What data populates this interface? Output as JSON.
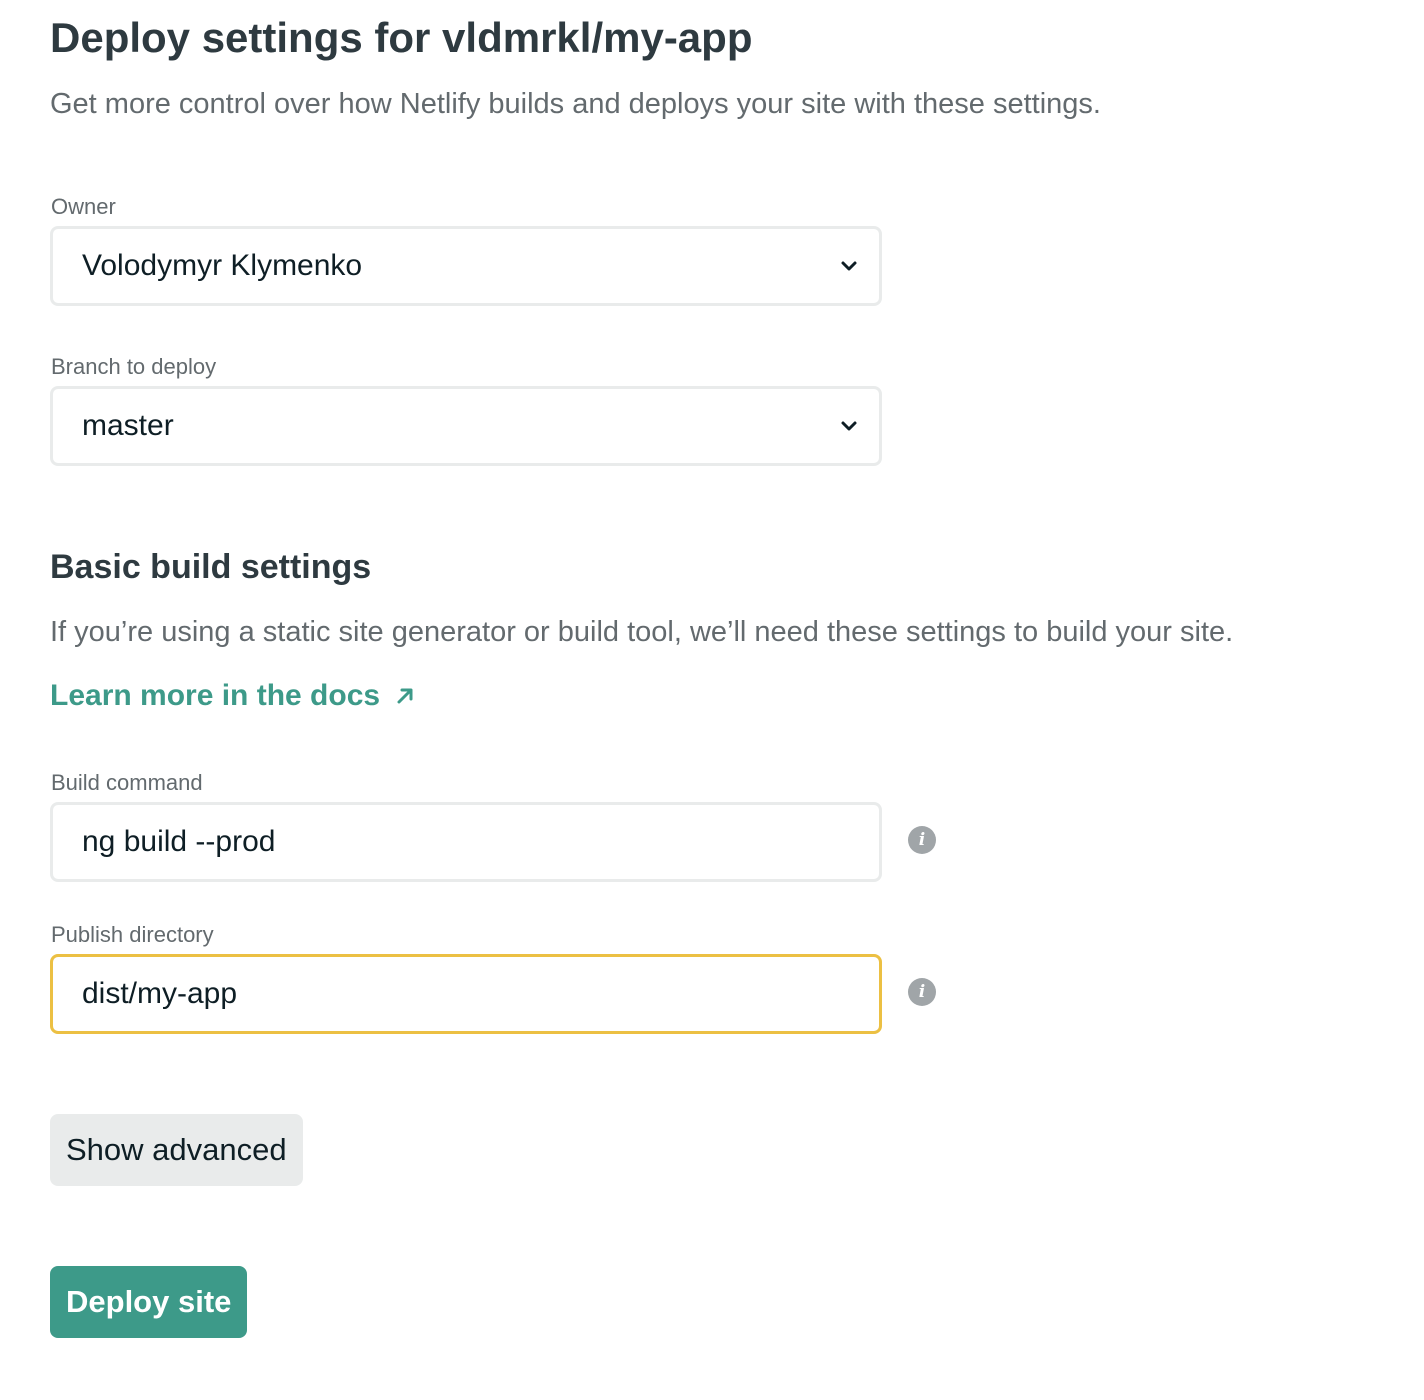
{
  "header": {
    "title": "Deploy settings for vldmrkl/my-app",
    "subtitle": "Get more control over how Netlify builds and deploys your site with these settings."
  },
  "owner": {
    "label": "Owner",
    "value": "Volodymyr Klymenko",
    "icon": "chevron-down-icon"
  },
  "branch": {
    "label": "Branch to deploy",
    "value": "master",
    "icon": "chevron-down-icon"
  },
  "build_settings": {
    "title": "Basic build settings",
    "description": "If you’re using a static site generator or build tool, we’ll need these settings to build your site.",
    "docs_link": "Learn more in the docs",
    "docs_link_icon": "external-arrow-icon",
    "build_command": {
      "label": "Build command",
      "value": "ng build --prod",
      "info_icon": "i"
    },
    "publish_directory": {
      "label": "Publish directory",
      "value": "dist/my-app",
      "info_icon": "i",
      "focused": true
    }
  },
  "actions": {
    "show_advanced": "Show advanced",
    "deploy": "Deploy site"
  },
  "colors": {
    "accent": "#3d9a89",
    "focus_border": "#ecc043",
    "text_dark": "#2e3a40",
    "text_muted": "#636a6e",
    "info_icon_bg": "#a0a5a8"
  }
}
